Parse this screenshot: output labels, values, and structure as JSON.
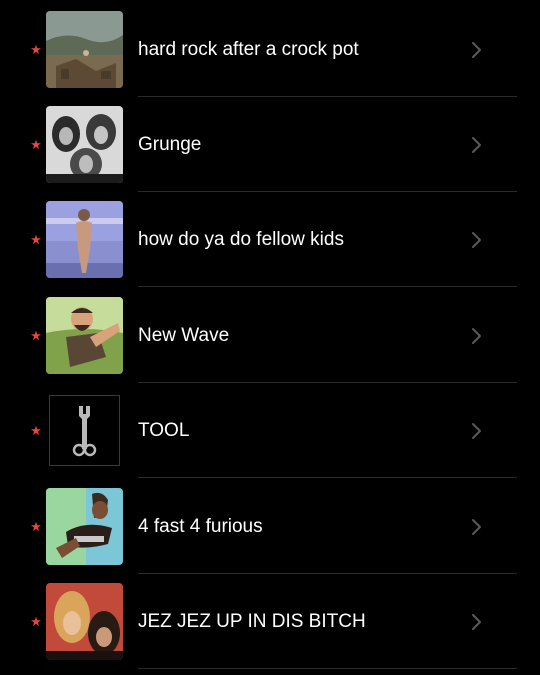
{
  "playlists": [
    {
      "title": "hard rock after a crock pot",
      "favorite_icon": "star-icon",
      "artwork": "landscape-painting-artwork"
    },
    {
      "title": "Grunge",
      "favorite_icon": "star-icon",
      "artwork": "band-photo-artwork"
    },
    {
      "title": "how do ya do fellow kids",
      "favorite_icon": "star-icon",
      "artwork": "figure-artwork"
    },
    {
      "title": "New Wave",
      "favorite_icon": "star-icon",
      "artwork": "cartoon-man-artwork"
    },
    {
      "title": "TOOL",
      "favorite_icon": "star-icon",
      "artwork": "wrench-artwork"
    },
    {
      "title": "4 fast 4 furious",
      "favorite_icon": "star-icon",
      "artwork": "cartoon-hand-artwork"
    },
    {
      "title": "JEZ JEZ UP IN DIS BITCH",
      "favorite_icon": "star-icon",
      "artwork": "rock-band-artwork"
    }
  ],
  "colors": {
    "background": "#000000",
    "star": "#e8453c",
    "chevron": "#5a5a5e",
    "separator": "#2a2a2c"
  }
}
